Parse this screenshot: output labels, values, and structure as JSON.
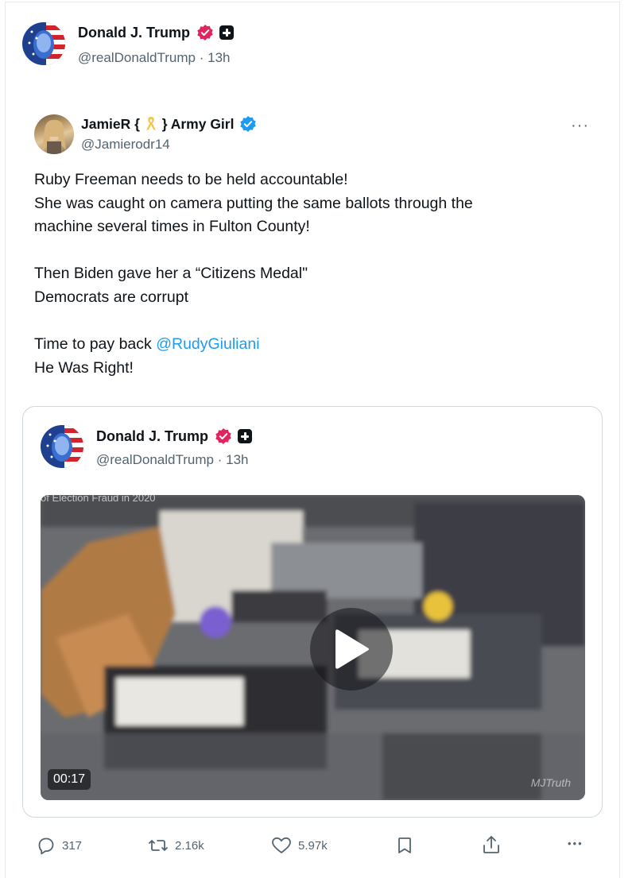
{
  "post": {
    "author": {
      "name": "Donald J. Trump",
      "handle": "@realDonaldTrump",
      "time": "13h"
    },
    "separator": "·"
  },
  "retweet": {
    "author": {
      "name_prefix": "JamieR {",
      "name_suffix": "} Army Girl",
      "handle": "@Jamierodr14"
    },
    "more_label": "···",
    "text_lines": [
      "Ruby Freeman needs to be held accountable!",
      "She was caught on camera putting the same ballots through the",
      "machine several times in Fulton County!",
      "",
      "Then Biden gave her a “Citizens Medal\"",
      "Democrats are corrupt",
      "",
      "Time to pay back ",
      "He Was Right!"
    ],
    "mention": "@RudyGiuliani"
  },
  "quoted": {
    "author": {
      "name": "Donald J. Trump",
      "handle": "@realDonaldTrump",
      "time": "13h"
    },
    "video": {
      "duration": "00:17",
      "overlay_text": "of Election Fraud in 2020",
      "watermark": "MJTruth"
    }
  },
  "actions": {
    "replies": "317",
    "reposts": "2.16k",
    "likes": "5.97k",
    "more_label": "•••"
  },
  "colors": {
    "verified": "#e0245e",
    "link": "#1d9bf0",
    "muted": "#536471"
  }
}
